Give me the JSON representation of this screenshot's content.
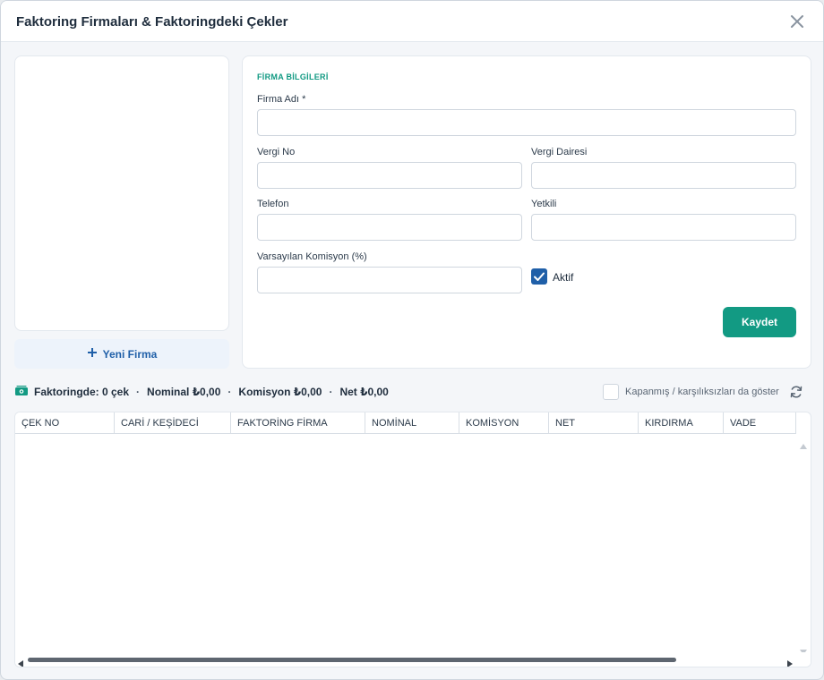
{
  "window": {
    "title": "Faktoring Firmaları & Faktoringdeki Çekler"
  },
  "icons": {
    "close": "close-icon",
    "plus": "plus-icon",
    "money": "money-icon",
    "check": "check-icon",
    "refresh": "refresh-icon"
  },
  "colors": {
    "accent": "#129a83",
    "primary": "#1f5fa8",
    "border": "#cfd6de"
  },
  "sidebar": {
    "new_firm_label": "Yeni Firma"
  },
  "form": {
    "section_title": "FİRMA BİLGİLERİ",
    "firma_adi": {
      "label": "Firma Adı *",
      "value": ""
    },
    "vergi_no": {
      "label": "Vergi No",
      "value": ""
    },
    "vergi_dairesi": {
      "label": "Vergi Dairesi",
      "value": ""
    },
    "telefon": {
      "label": "Telefon",
      "value": ""
    },
    "yetkili": {
      "label": "Yetkili",
      "value": ""
    },
    "komisyon": {
      "label": "Varsayılan Komisyon (%)",
      "value": ""
    },
    "aktif": {
      "label": "Aktif",
      "checked": true
    },
    "save_label": "Kaydet"
  },
  "summary": {
    "count": "Faktoringde: 0 çek",
    "nominal": "Nominal ₺0,00",
    "komisyon": "Komisyon ₺0,00",
    "net": "Net ₺0,00",
    "separator": "·"
  },
  "filter": {
    "show_closed_label": "Kapanmış / karşılıksızları da göster",
    "checked": false
  },
  "grid": {
    "columns": [
      "ÇEK NO",
      "CARİ / KEŞİDECİ",
      "FAKTORİNG FİRMA",
      "NOMİNAL",
      "KOMİSYON",
      "NET",
      "KIRDIRMA",
      "VADE"
    ],
    "rows": []
  }
}
